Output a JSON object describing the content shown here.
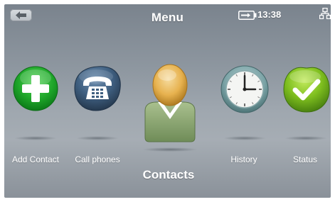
{
  "header": {
    "title": "Menu",
    "time": "13:38"
  },
  "carousel": {
    "items": [
      {
        "label": "Add Contact",
        "icon": "add-contact-icon"
      },
      {
        "label": "Call phones",
        "icon": "phone-icon"
      },
      {
        "label": "Contacts",
        "icon": "contacts-icon",
        "selected": true
      },
      {
        "label": "History",
        "icon": "clock-icon"
      },
      {
        "label": "Status",
        "icon": "status-check-icon"
      }
    ]
  },
  "colors": {
    "add": "#1fa72a",
    "phone": "#3f5f80",
    "contact_head": "#e7b24f",
    "contact_body": "#86a26e",
    "clock": "#7ba3a6",
    "status": "#7fbf1f"
  }
}
